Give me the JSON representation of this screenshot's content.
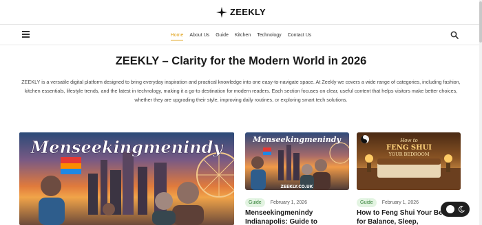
{
  "brand": {
    "logo_text": "ZEEKLY",
    "accent_color": "#e0a21a"
  },
  "nav": {
    "menu_icon": "hamburger-menu-icon",
    "items": [
      {
        "label": "Home",
        "active": true
      },
      {
        "label": "About Us"
      },
      {
        "label": "Guide"
      },
      {
        "label": "Kitchen"
      },
      {
        "label": "Technology"
      },
      {
        "label": "Contact Us"
      }
    ],
    "search_icon": "search-icon"
  },
  "hero": {
    "title": "ZEEKLY – Clarity for the Modern World in 2026",
    "description": "ZEEKLY is a versatile digital platform designed to bring everyday inspiration and practical knowledge into one easy-to-navigate space. At Zeekly we covers a wide range of categories, including fashion, kitchen essentials, lifestyle trends, and the latest in technology, making it a go-to destination for modern readers. Each section focuses on clear, useful content that helps visitors make better choices, whether they are upgrading their style, improving daily routines, or exploring smart tech solutions."
  },
  "featured": {
    "image_text": "Menseekingmenindy"
  },
  "cards": [
    {
      "image_text": "Menseekingmenindy",
      "image_caption": "ZEEKLY.CO.UK",
      "tag": "Guide",
      "date": "February 1, 2026",
      "title": "Menseekingmenindy Indianapolis: Guide to"
    },
    {
      "image_text_line1": "How to",
      "image_text_line2": "FENG SHUI",
      "image_text_line3": "YOUR BEDROOM",
      "tag": "Guide",
      "date": "February 1, 2026",
      "title": "How to Feng Shui Your Bedroom for Balance, Sleep,"
    }
  ],
  "theme_toggle": {
    "icon": "moon-icon",
    "background": "#1f1f1f"
  }
}
